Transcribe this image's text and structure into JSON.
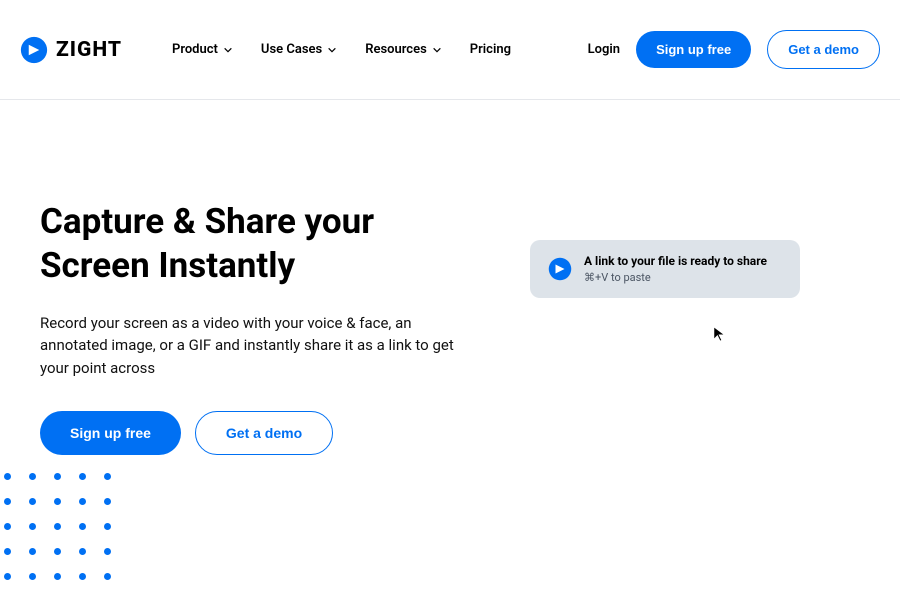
{
  "header": {
    "logo_text": "ZIGHT",
    "nav": {
      "product": "Product",
      "use_cases": "Use Cases",
      "resources": "Resources",
      "pricing": "Pricing"
    },
    "login": "Login",
    "signup": "Sign up free",
    "demo": "Get a demo"
  },
  "hero": {
    "title": "Capture & Share your Screen Instantly",
    "subtitle": "Record your screen as a video with your voice & face, an annotated image, or a GIF and instantly share it as a link to get your point across",
    "signup": "Sign up free",
    "demo": "Get a demo"
  },
  "notification": {
    "title": "A link to your file is ready to share",
    "subtitle": "⌘+V to paste"
  },
  "colors": {
    "primary": "#0070f3"
  }
}
